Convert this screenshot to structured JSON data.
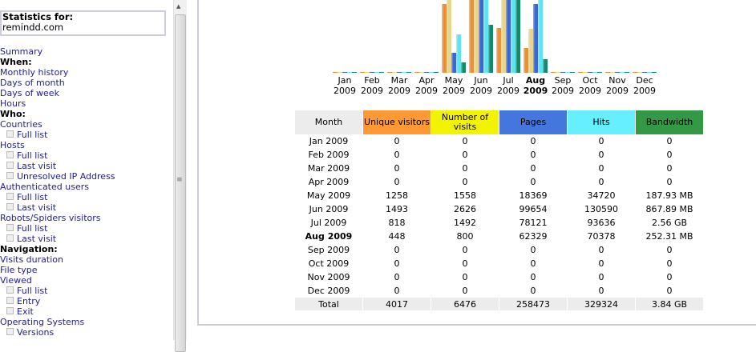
{
  "sidebar": {
    "stats_label": "Statistics for:",
    "site": "remindd.com",
    "items": [
      {
        "label": "Summary",
        "type": "link"
      },
      {
        "label": "When:",
        "type": "heading"
      },
      {
        "label": "Monthly history",
        "type": "link"
      },
      {
        "label": "Days of month",
        "type": "link"
      },
      {
        "label": "Days of week",
        "type": "link"
      },
      {
        "label": "Hours",
        "type": "link"
      },
      {
        "label": "Who:",
        "type": "heading"
      },
      {
        "label": "Countries",
        "type": "link"
      },
      {
        "label": "Full list",
        "type": "sub"
      },
      {
        "label": "Hosts",
        "type": "link"
      },
      {
        "label": "Full list",
        "type": "sub"
      },
      {
        "label": "Last visit",
        "type": "sub"
      },
      {
        "label": "Unresolved IP Address",
        "type": "sub"
      },
      {
        "label": "Authenticated users",
        "type": "link"
      },
      {
        "label": "Full list",
        "type": "sub"
      },
      {
        "label": "Last visit",
        "type": "sub"
      },
      {
        "label": "Robots/Spiders visitors",
        "type": "link"
      },
      {
        "label": "Full list",
        "type": "sub"
      },
      {
        "label": "Last visit",
        "type": "sub"
      },
      {
        "label": "Navigation:",
        "type": "heading"
      },
      {
        "label": "Visits duration",
        "type": "link"
      },
      {
        "label": "File type",
        "type": "link"
      },
      {
        "label": "Viewed",
        "type": "link"
      },
      {
        "label": "Full list",
        "type": "sub"
      },
      {
        "label": "Entry",
        "type": "sub"
      },
      {
        "label": "Exit",
        "type": "sub"
      },
      {
        "label": "Operating Systems",
        "type": "link"
      },
      {
        "label": "Versions",
        "type": "sub"
      }
    ]
  },
  "colors": {
    "unique": "#ff9933",
    "visits": "#f3f300",
    "pages": "#4477dd",
    "hits": "#66f0ff",
    "bandwidth": "#339944",
    "header_month": "#ececec"
  },
  "table": {
    "headers": [
      "Month",
      "Unique visitors",
      "Number of visits",
      "Pages",
      "Hits",
      "Bandwidth"
    ],
    "rows": [
      [
        "Jan 2009",
        "0",
        "0",
        "0",
        "0",
        "0"
      ],
      [
        "Feb 2009",
        "0",
        "0",
        "0",
        "0",
        "0"
      ],
      [
        "Mar 2009",
        "0",
        "0",
        "0",
        "0",
        "0"
      ],
      [
        "Apr 2009",
        "0",
        "0",
        "0",
        "0",
        "0"
      ],
      [
        "May 2009",
        "1258",
        "1558",
        "18369",
        "34720",
        "187.93 MB"
      ],
      [
        "Jun 2009",
        "1493",
        "2626",
        "99654",
        "130590",
        "867.89 MB"
      ],
      [
        "Jul 2009",
        "818",
        "1492",
        "78121",
        "93636",
        "2.56 GB"
      ],
      [
        "Aug 2009",
        "448",
        "800",
        "62329",
        "70378",
        "252.31 MB"
      ],
      [
        "Sep 2009",
        "0",
        "0",
        "0",
        "0",
        "0"
      ],
      [
        "Oct 2009",
        "0",
        "0",
        "0",
        "0",
        "0"
      ],
      [
        "Nov 2009",
        "0",
        "0",
        "0",
        "0",
        "0"
      ],
      [
        "Dec 2009",
        "0",
        "0",
        "0",
        "0",
        "0"
      ]
    ],
    "current_month_index": 7,
    "total": [
      "Total",
      "4017",
      "6476",
      "258473",
      "329324",
      "3.84 GB"
    ]
  },
  "chart_data": {
    "type": "bar",
    "categories": [
      [
        "Jan",
        "2009"
      ],
      [
        "Feb",
        "2009"
      ],
      [
        "Mar",
        "2009"
      ],
      [
        "Apr",
        "2009"
      ],
      [
        "May",
        "2009"
      ],
      [
        "Jun",
        "2009"
      ],
      [
        "Jul",
        "2009"
      ],
      [
        "Aug",
        "2009"
      ],
      [
        "Sep",
        "2009"
      ],
      [
        "Oct",
        "2009"
      ],
      [
        "Nov",
        "2009"
      ],
      [
        "Dec",
        "2009"
      ]
    ],
    "highlight_index": 7,
    "series": [
      {
        "key": "unique",
        "values": [
          0,
          0,
          0,
          0,
          1258,
          1493,
          818,
          448,
          0,
          0,
          0,
          0
        ],
        "color": "#e8913a"
      },
      {
        "key": "visits",
        "values": [
          0,
          0,
          0,
          0,
          1558,
          2626,
          1492,
          800,
          0,
          0,
          0,
          0
        ],
        "color": "#e6d58a"
      },
      {
        "key": "pages",
        "values": [
          0,
          0,
          0,
          0,
          18369,
          99654,
          78121,
          62329,
          0,
          0,
          0,
          0
        ],
        "color": "#3a66d8"
      },
      {
        "key": "hits",
        "values": [
          0,
          0,
          0,
          0,
          34720,
          130590,
          93636,
          70378,
          0,
          0,
          0,
          0
        ],
        "color": "#5ee4ef"
      },
      {
        "key": "bandwidth_mb",
        "values": [
          0,
          0,
          0,
          0,
          187.93,
          867.89,
          2621.44,
          252.31,
          0,
          0,
          0,
          0
        ],
        "color": "#128a6a"
      }
    ]
  }
}
